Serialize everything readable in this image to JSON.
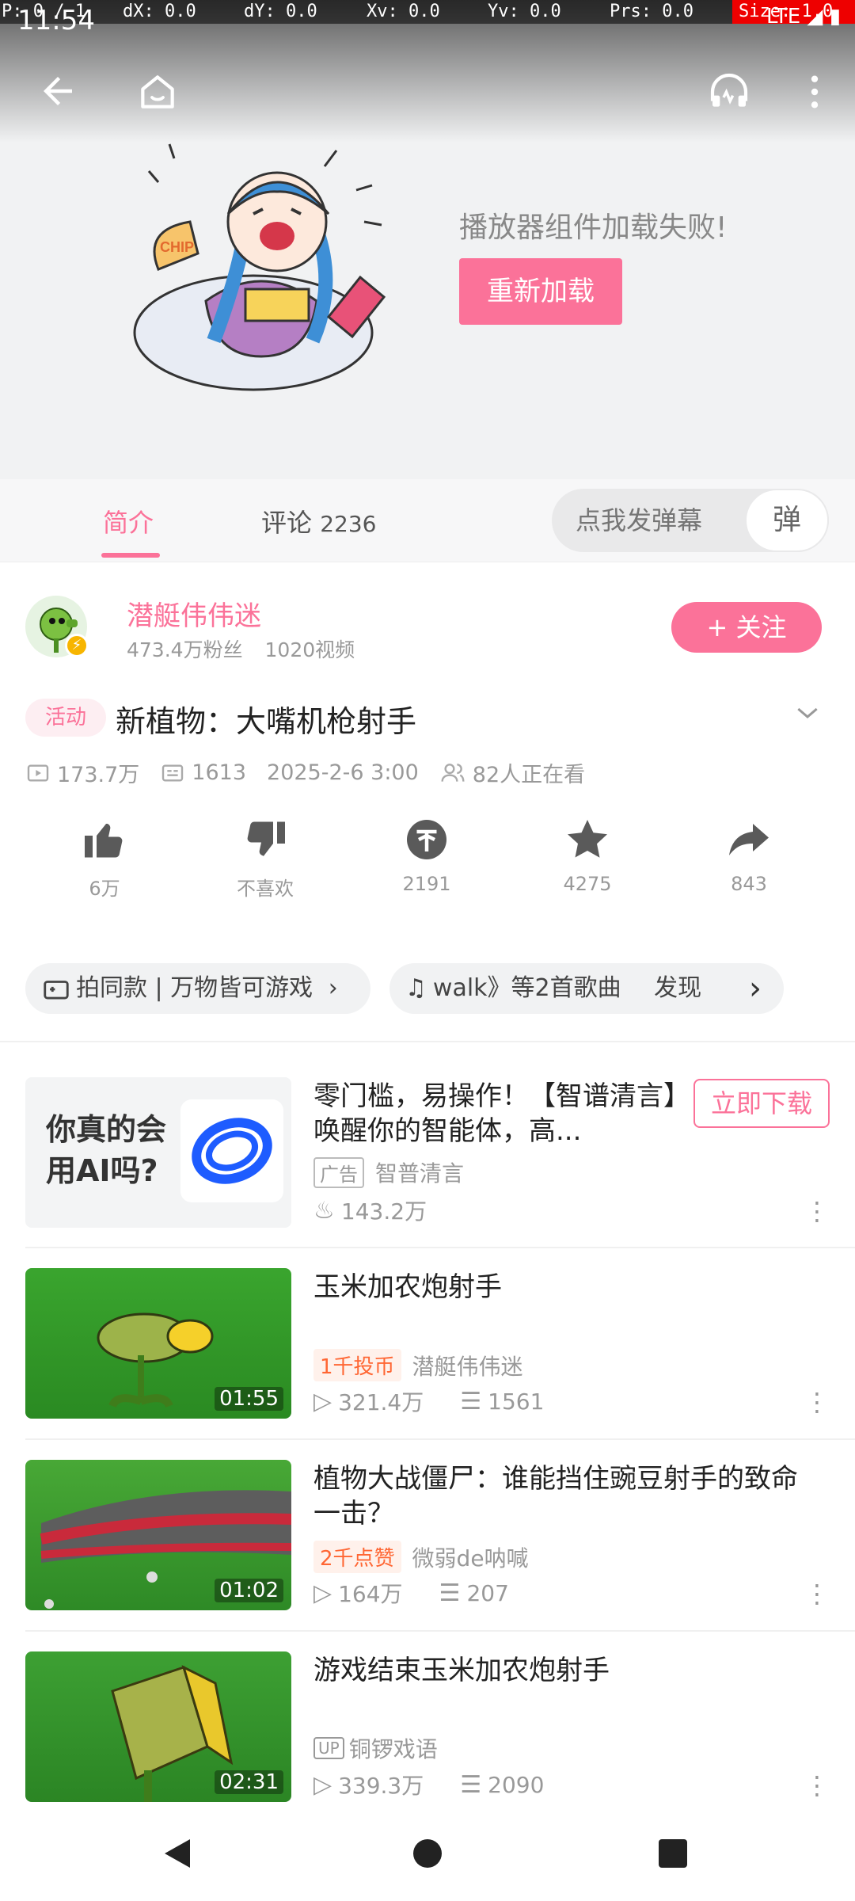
{
  "debug": {
    "pointer": "P: 0 / 1",
    "dx": "dX: 0.0",
    "dy": "dY: 0.0",
    "xv": "Xv: 0.0",
    "yv": "Yv: 0.0",
    "prs": "Prs: 0.0",
    "size": "Size: 1.0"
  },
  "status_bar": {
    "time": "11:54",
    "network": "LTE"
  },
  "player": {
    "error_text": "播放器组件加载失败!",
    "reload_label": "重新加载"
  },
  "tabs": {
    "intro": "简介",
    "comments": "评论",
    "comments_count": "2236",
    "danmaku_placeholder": "点我发弹幕",
    "danmaku_button": "弹"
  },
  "uploader": {
    "name": "潜艇伟伟迷",
    "fans": "473.4万粉丝",
    "videos": "1020视频",
    "follow_label": "+ 关注"
  },
  "video": {
    "activity_tag": "活动",
    "title": "新植物：大嘴机枪射手",
    "views": "173.7万",
    "danmaku": "1613",
    "date": "2025-2-6 3:00",
    "watching": "82人正在看"
  },
  "actions": {
    "like": "6万",
    "dislike": "不喜欢",
    "coin": "2191",
    "favorite": "4275",
    "share": "843"
  },
  "chips": {
    "game": "拍同款 | 万物皆可游戏",
    "music": "walk》等2首歌曲",
    "discover": "发现"
  },
  "ad": {
    "thumb_text": "你真的会用AI吗?",
    "title": "零门槛，易操作！【智谱清言】唤醒你的智能体，高...",
    "download_label": "立即下载",
    "badge": "广告",
    "brand": "智普清言",
    "heat": "143.2万"
  },
  "feed": [
    {
      "title": "玉米加农炮射手",
      "duration": "01:55",
      "badge": "1千投币",
      "author": "潜艇伟伟迷",
      "views": "321.4万",
      "danmaku": "1561"
    },
    {
      "title": "植物大战僵尸：谁能挡住豌豆射手的致命一击？",
      "duration": "01:02",
      "badge": "2千点赞",
      "author": "微弱de呐喊",
      "views": "164万",
      "danmaku": "207"
    },
    {
      "title": "游戏结束玉米加农炮射手",
      "duration": "02:31",
      "up_badge": "UP",
      "author": "铜锣戏语",
      "views": "339.3万",
      "danmaku": "2090"
    }
  ],
  "colors": {
    "accent": "#fb7299",
    "orange_badge": "#ff6633"
  },
  "icons": [
    "back-icon",
    "home-icon",
    "headphones-icon",
    "more-vertical-icon",
    "play-count-icon",
    "danmaku-count-icon",
    "watching-icon",
    "thumbs-up-icon",
    "thumbs-down-icon",
    "coin-icon",
    "star-icon",
    "share-icon",
    "game-icon",
    "music-note-icon",
    "chevron-right-icon",
    "fire-icon",
    "nav-back-icon",
    "nav-home-icon",
    "nav-recents-icon"
  ]
}
